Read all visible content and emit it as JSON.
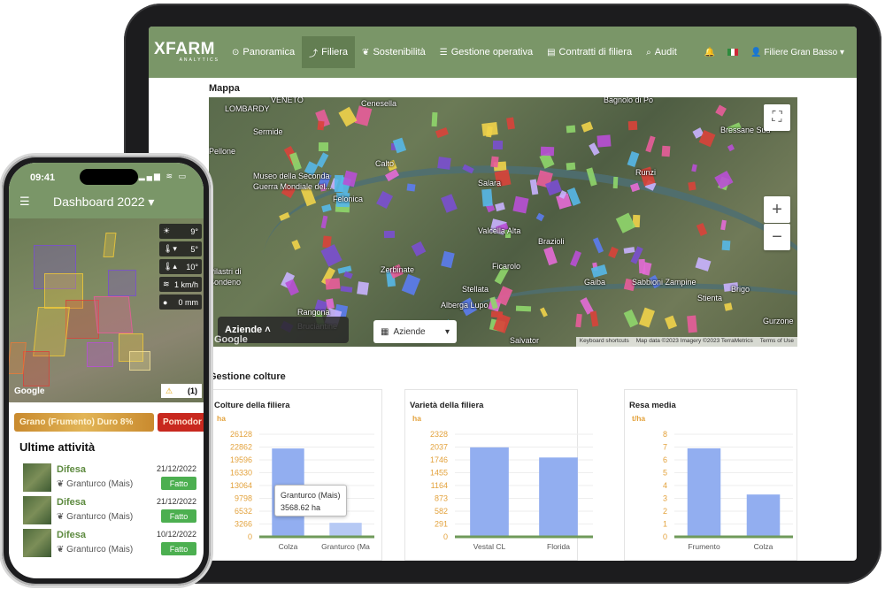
{
  "tablet": {
    "logo": {
      "main": "XFARM",
      "sub": "ANALYTICS"
    },
    "nav": [
      {
        "label": "Panoramica",
        "icon": "⊙"
      },
      {
        "label": "Filiera",
        "icon": "⤴"
      },
      {
        "label": "Sostenibilità",
        "icon": "❦"
      },
      {
        "label": "Gestione operativa",
        "icon": "☰"
      },
      {
        "label": "Contratti di filiera",
        "icon": "▤"
      },
      {
        "label": "Audit",
        "icon": "⌕"
      }
    ],
    "user": "Filiere Gran Basso",
    "map_title": "Mappa",
    "map": {
      "places": [
        "VENETO",
        "LOMBARDY",
        "Cenesella",
        "Bagnolo di Po",
        "Sermide",
        "Bressane Sud",
        "Pellone",
        "Calto",
        "Museo della Seconda",
        "Guerra Mondiale del...",
        "Felonica",
        "Salara",
        "Runzi",
        "Valcella Alta",
        "Brazioli",
        "Zerbinate",
        "Ficarolo",
        "Pilastri di",
        "Bondeno",
        "Stellata",
        "Gaiba",
        "Sabbioni Zampine",
        "Stienta",
        "Brigo",
        "Alberga Lupo",
        "Rangona",
        "Gurzone",
        "Salvator",
        "Bruciantine"
      ],
      "aziende_label": "Aziende",
      "select_label": "Aziende",
      "attribution": [
        "Keyboard shortcuts",
        "Map data ©2023 Imagery ©2023 TerraMetrics",
        "Terms of Use"
      ],
      "google": "Google"
    },
    "crops_title": "Gestione colture",
    "cards": [
      {
        "title": "Colture della filiera",
        "unit": "ha"
      },
      {
        "title": "Varietà della filiera",
        "unit": "ha"
      },
      {
        "title": "Resa media",
        "unit": "t/ha"
      }
    ],
    "tooltip": {
      "name": "Granturco (Mais)",
      "value": "3568.62 ha"
    }
  },
  "chart_data": [
    {
      "type": "bar",
      "title": "Colture della filiera",
      "ylabel": "ha",
      "categories": [
        "Colza",
        "Granturco (Mais)"
      ],
      "category_labels": [
        "Colza",
        "Granturco (Ma"
      ],
      "values": [
        22500,
        3568.62
      ],
      "ylim": [
        0,
        26128
      ],
      "yticks": [
        "26128",
        "22862",
        "19596",
        "16330",
        "13064",
        "9798",
        "6532",
        "3266",
        "0"
      ],
      "grid": true
    },
    {
      "type": "bar",
      "title": "Varietà della filiera",
      "ylabel": "ha",
      "categories": [
        "Vestal CL",
        "Florida"
      ],
      "values": [
        2030,
        1800
      ],
      "ylim": [
        0,
        2328
      ],
      "yticks": [
        "2328",
        "2037",
        "1746",
        "1455",
        "1164",
        "873",
        "582",
        "291",
        "0"
      ],
      "grid": true
    },
    {
      "type": "bar",
      "title": "Resa media",
      "ylabel": "t/ha",
      "categories": [
        "Frumento",
        "Colza"
      ],
      "values": [
        6.9,
        3.3
      ],
      "ylim": [
        0,
        8
      ],
      "yticks": [
        "8",
        "7",
        "6",
        "5",
        "4",
        "3",
        "2",
        "1",
        "0"
      ],
      "grid": true
    }
  ],
  "phone": {
    "time": "09:41",
    "status": "▂▄▆ ≋ ▭",
    "title": "Dashboard 2022",
    "weather": [
      {
        "icon": "☀",
        "value": "9°"
      },
      {
        "icon": "🌡▾",
        "value": "5°"
      },
      {
        "icon": "🌡▴",
        "value": "10°"
      },
      {
        "icon": "≋",
        "value": "1 km/h"
      },
      {
        "icon": "●",
        "value": "0 mm"
      }
    ],
    "warning": {
      "icon": "⚠",
      "count": "(1)"
    },
    "google": "Google",
    "chips": [
      "Grano (Frumento) Duro 8%",
      "Pomodor"
    ],
    "list_title": "Ultime attività",
    "activities": [
      {
        "name": "Difesa",
        "crop": "Granturco (Mais)",
        "date": "21/12/2022",
        "status": "Fatto"
      },
      {
        "name": "Difesa",
        "crop": "Granturco (Mais)",
        "date": "21/12/2022",
        "status": "Fatto"
      },
      {
        "name": "Difesa",
        "crop": "Granturco (Mais)",
        "date": "10/12/2022",
        "status": "Fatto"
      }
    ]
  }
}
